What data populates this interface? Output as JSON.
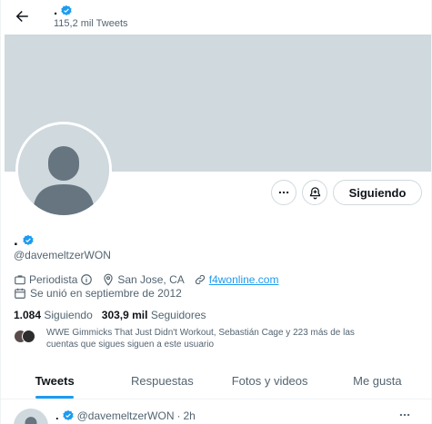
{
  "header": {
    "name": ".",
    "tweet_count": "115,2 mil Tweets"
  },
  "actions": {
    "follow_label": "Siguiendo"
  },
  "profile": {
    "name": ".",
    "handle": "@davemeltzerWON",
    "category": "Periodista",
    "location": "San Jose, CA",
    "website": "f4wonline.com",
    "joined": "Se unió en septiembre de 2012",
    "following_count": "1.084",
    "following_label": "Siguiendo",
    "followers_count": "303,9 mil",
    "followers_label": "Seguidores",
    "followers_you_know": "WWE Gimmicks That Just Didn't Workout, Sebastián Cage y 223 más de las cuentas que sigues siguen a este usuario"
  },
  "tabs": [
    {
      "label": "Tweets",
      "active": true
    },
    {
      "label": "Respuestas",
      "active": false
    },
    {
      "label": "Fotos y videos",
      "active": false
    },
    {
      "label": "Me gusta",
      "active": false
    }
  ],
  "tweet": {
    "name": ".",
    "handle": "@davemeltzerWON",
    "separator": "·",
    "time": "2h"
  },
  "colors": {
    "accent": "#1d9bf0",
    "banner": "#cfd9de",
    "secondary_text": "#536471"
  },
  "icons": [
    "back-arrow-icon",
    "verified-badge-icon",
    "more-icon",
    "notification-bell-icon",
    "briefcase-info-icon",
    "location-pin-icon",
    "link-icon",
    "calendar-icon"
  ]
}
